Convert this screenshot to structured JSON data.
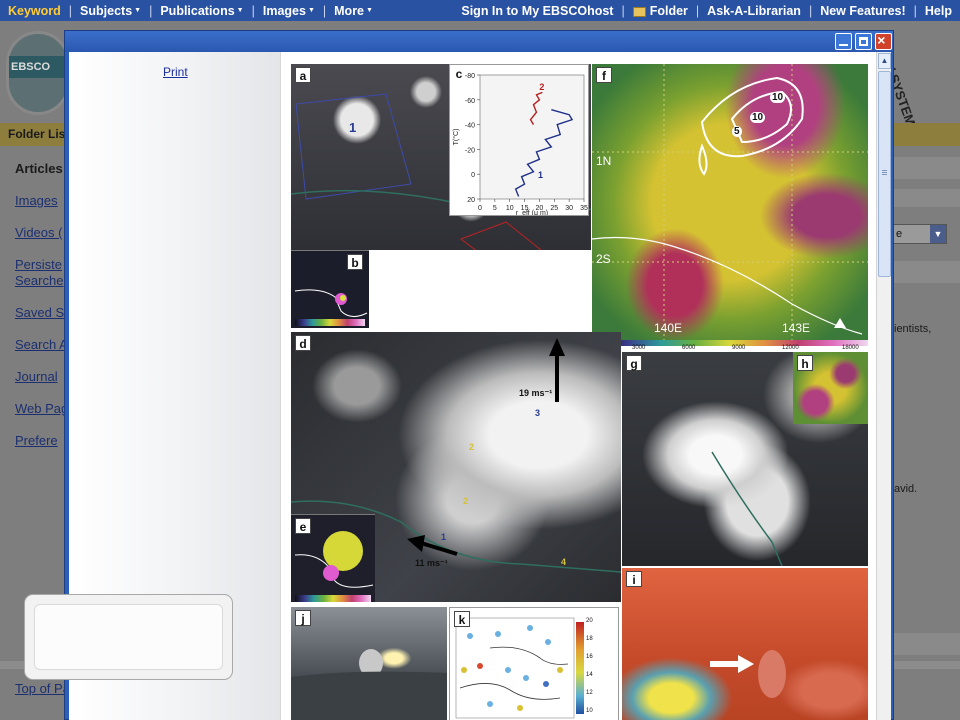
{
  "topnav": {
    "left": [
      {
        "label": "Keyword",
        "caret": false
      },
      {
        "label": "Subjects",
        "caret": true
      },
      {
        "label": "Publications",
        "caret": true
      },
      {
        "label": "Images",
        "caret": true
      },
      {
        "label": "More",
        "caret": true
      }
    ],
    "right": [
      {
        "label": "Sign In to My EBSCOhost"
      },
      {
        "label": "Folder",
        "icon": "folder-icon"
      },
      {
        "label": "Ask-A-Librarian"
      },
      {
        "label": "New Features!"
      },
      {
        "label": "Help"
      }
    ]
  },
  "background": {
    "logo_text": "EBSCO HOST",
    "folder_list_label": "Folder Lis",
    "side_items": [
      "Articles",
      "Images",
      "Videos (",
      "Persiste",
      "Searche",
      "Saved S",
      "Search A",
      "Journal",
      "Web Pag",
      "Prefere"
    ],
    "system_text": "Y SYSTEM",
    "select_value": "e",
    "right_text_1": "ientists,",
    "right_text_2": "avid.",
    "bottom_link": "Top of Pa"
  },
  "modal": {
    "print_label": "Print",
    "window_buttons": [
      "minimize-icon",
      "maximize-icon",
      "close-icon"
    ]
  },
  "figure": {
    "panel_labels": [
      "a",
      "b",
      "c",
      "d",
      "e",
      "f",
      "g",
      "h",
      "i",
      "j",
      "k"
    ],
    "panel_a": {
      "labels": [
        "1",
        "2"
      ]
    },
    "panel_c": {
      "y_ticks": [
        "-80",
        "-60",
        "-40",
        "-20",
        "0",
        "20"
      ],
      "x_ticks": [
        "0",
        "5",
        "10",
        "15",
        "20",
        "25",
        "30",
        "35"
      ],
      "ylabel": "T(°C)",
      "xlabel": "r_eff (μ m)",
      "series_labels": [
        "1",
        "2"
      ]
    },
    "panel_d": {
      "labels": [
        "19 ms⁻¹",
        "3",
        "2",
        "2",
        "1",
        "11 ms⁻¹",
        "4"
      ]
    },
    "panel_f": {
      "grid_labels": [
        "1N",
        "2S",
        "140E",
        "143E"
      ],
      "contour_labels": [
        "10",
        "10",
        "5"
      ],
      "colorbar_ticks": [
        "0",
        "3000",
        "6000",
        "9000",
        "12000",
        "18000"
      ]
    },
    "panel_k": {
      "colorbar_ticks": [
        "20",
        "18",
        "16",
        "14",
        "12",
        "10"
      ]
    }
  },
  "colors": {
    "nav_bg": "#2a52a3",
    "nav_highlight": "#ffcc33",
    "modal_border": "#2c5fb8",
    "close_button": "#d0432a"
  }
}
